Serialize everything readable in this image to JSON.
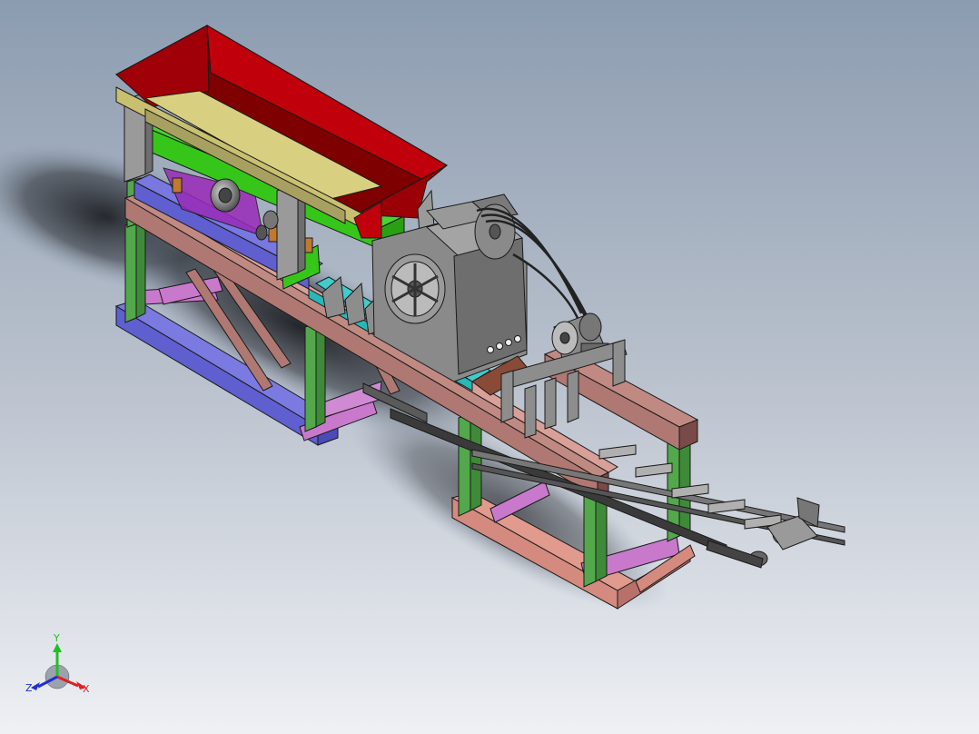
{
  "colors": {
    "background_top": "#8c9cb0",
    "background_bottom": "#eef0f4",
    "hopper": "#c0000a",
    "hopper_dark": "#7e0000",
    "screen_deck": "#d8d080",
    "screen_frame": "#36c61a",
    "vibrating_base": "#5f5fd0",
    "frame_green": "#52a84a",
    "beam_brown": "#b07872",
    "beam_dark": "#7a4a48",
    "base_pink": "#c979cc",
    "base_salmon": "#d48a7e",
    "crusher_body": "#8a8a8a",
    "conveyor_cyan": "#29b8b8",
    "steel_grey": "#8d8d8d",
    "outline": "#1a1a1a",
    "axis_x": "#e02020",
    "axis_y": "#20c020",
    "axis_z": "#2030d0"
  },
  "triad": {
    "x_label": "X",
    "y_label": "Y",
    "z_label": "Z"
  },
  "components": {
    "hopper": "feed-hopper",
    "screen": "vibrating-screen",
    "crusher": "jaw-crusher",
    "motor": "electric-motor",
    "conveyor": "belt-conveyor",
    "frame": "support-frame"
  }
}
